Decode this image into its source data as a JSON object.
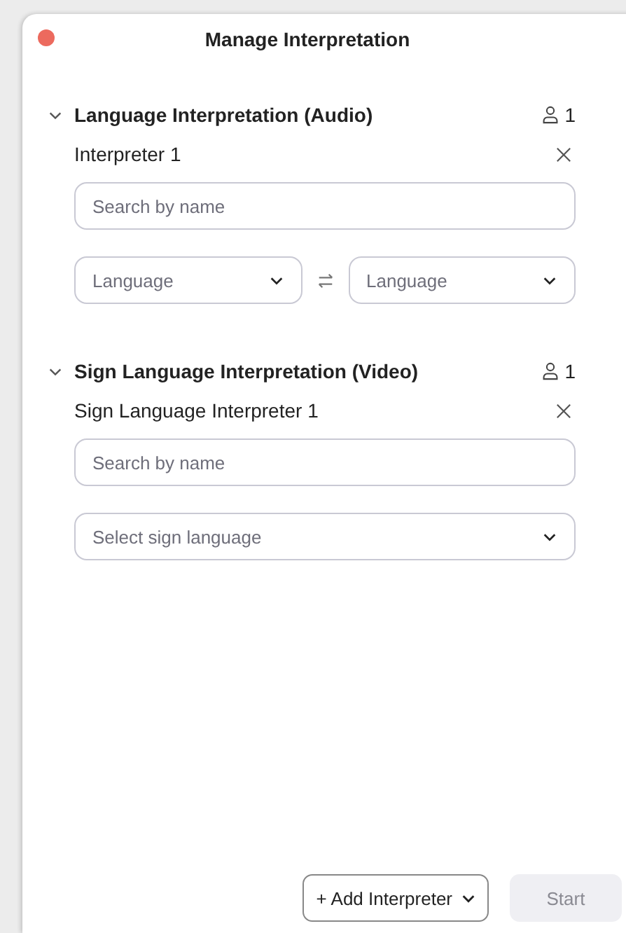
{
  "window": {
    "title": "Manage Interpretation"
  },
  "sections": [
    {
      "title": "Language Interpretation (Audio)",
      "expanded": true,
      "count": "1",
      "interpreters": [
        {
          "kind": "language_pair",
          "label": "Interpreter 1",
          "search": {
            "placeholder": "Search by name"
          },
          "selects": [
            {
              "placeholder": "Language"
            },
            {
              "placeholder": "Language"
            }
          ]
        }
      ]
    },
    {
      "title": "Sign Language Interpretation (Video)",
      "expanded": true,
      "count": "1",
      "interpreters": [
        {
          "kind": "sign_language",
          "label": "Sign Language Interpreter 1",
          "search": {
            "placeholder": "Search by name"
          },
          "selects": [
            {
              "placeholder": "Select sign language"
            }
          ]
        }
      ]
    }
  ],
  "footer": {
    "add_button": {
      "label": "+ Add Interpreter"
    },
    "start_button": {
      "label": "Start",
      "disabled": true
    }
  }
}
